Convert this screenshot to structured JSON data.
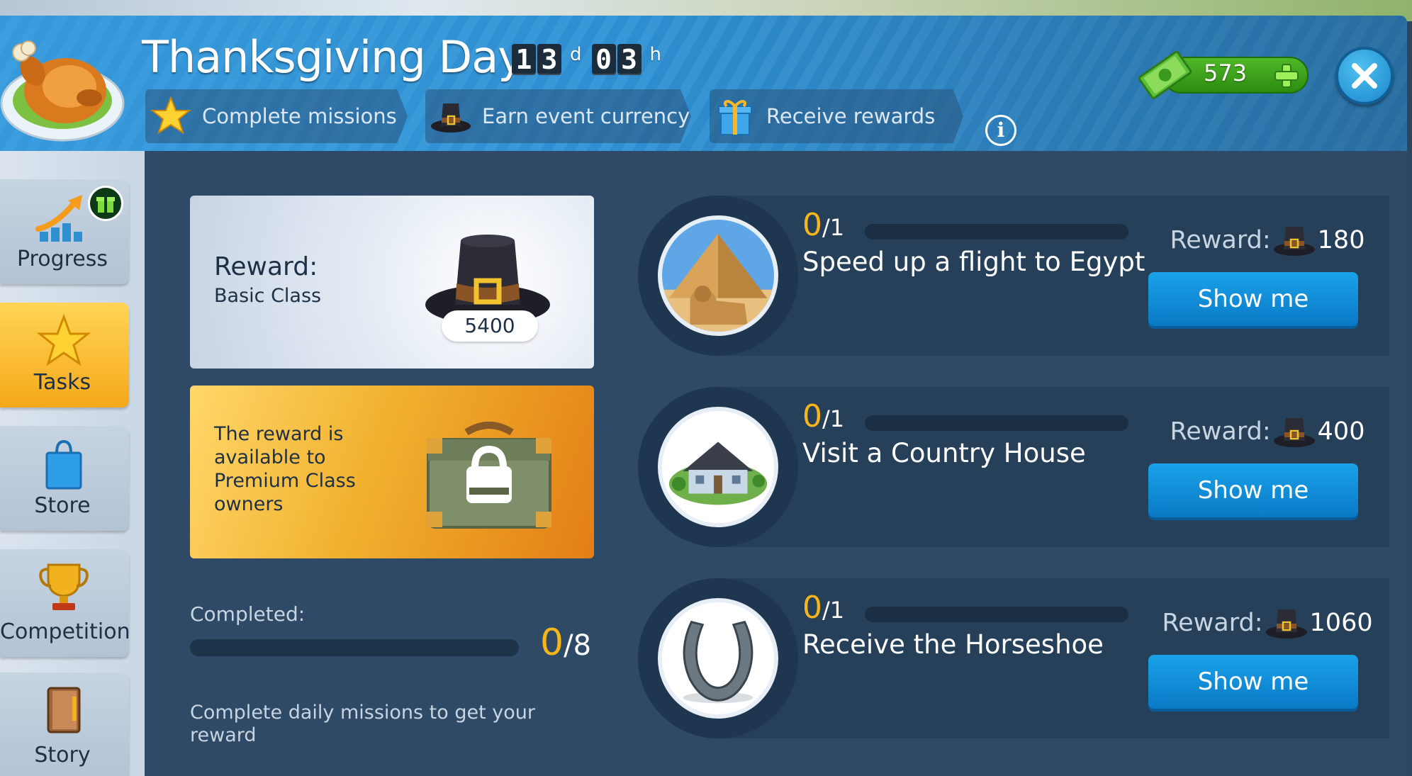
{
  "event": {
    "title": "Thanksgiving Day",
    "timer": {
      "days_digits": [
        "1",
        "3"
      ],
      "days_unit": "d",
      "hours_digits": [
        "0",
        "3"
      ],
      "hours_unit": "h"
    }
  },
  "steps": [
    {
      "label": "Complete missions",
      "icon": "star-icon"
    },
    {
      "label": "Earn event currency",
      "icon": "pilgrim-hat-icon"
    },
    {
      "label": "Receive rewards",
      "icon": "gift-icon"
    }
  ],
  "currency": {
    "value": "573",
    "icon": "cash-icon"
  },
  "sidebar": {
    "items": [
      {
        "label": "Progress",
        "icon": "progress-arrow-icon",
        "active": false
      },
      {
        "label": "Tasks",
        "icon": "star-icon",
        "active": true
      },
      {
        "label": "Store",
        "icon": "shopping-bag-icon",
        "active": false
      },
      {
        "label": "Competition",
        "icon": "trophy-icon",
        "active": false
      },
      {
        "label": "Story",
        "icon": "book-icon",
        "active": false
      }
    ]
  },
  "reward_card": {
    "title": "Reward:",
    "subtitle": "Basic Class",
    "amount": "5400"
  },
  "premium_card": {
    "text": "The reward is available to Premium Class owners"
  },
  "completed": {
    "label": "Completed:",
    "done": "0",
    "total": "/8",
    "fraction": 0
  },
  "hint": "Complete daily missions to get your reward",
  "missions": [
    {
      "done": "0",
      "total": "/1",
      "fraction": 0,
      "title": "Speed up a flight to Egypt",
      "reward_label": "Reward:",
      "reward_value": "180",
      "button": "Show me",
      "image": "pyramid-sphinx-image"
    },
    {
      "done": "0",
      "total": "/1",
      "fraction": 0,
      "title": "Visit a Country House",
      "reward_label": "Reward:",
      "reward_value": "400",
      "button": "Show me",
      "image": "country-house-image"
    },
    {
      "done": "0",
      "total": "/1",
      "fraction": 0,
      "title": "Receive the Horseshoe",
      "reward_label": "Reward:",
      "reward_value": "1060",
      "button": "Show me",
      "image": "horseshoe-image"
    }
  ]
}
